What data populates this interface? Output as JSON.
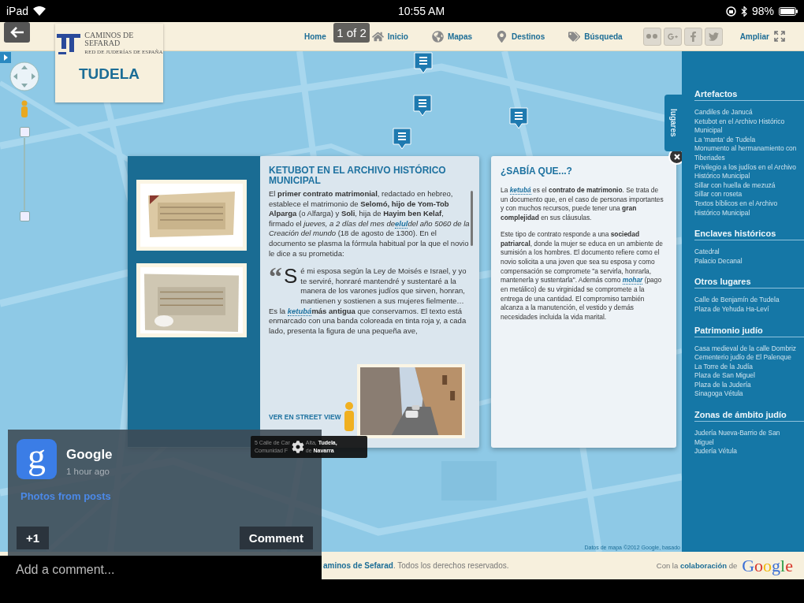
{
  "status_bar": {
    "device": "iPad",
    "time": "10:55 AM",
    "battery": "98%"
  },
  "header": {
    "logo": {
      "title_lines": [
        "CAMINOS DE",
        "SEFARAD"
      ],
      "subtitle": "RED DE JUDERÍAS DE ESPAÑA",
      "city": "TUDELA"
    },
    "nav": [
      {
        "label": "Home",
        "kind": "text"
      },
      {
        "label": "Inicio",
        "kind": "home"
      },
      {
        "label": "Mapas",
        "kind": "globe"
      },
      {
        "label": "Destinos",
        "kind": "pin"
      },
      {
        "label": "Búsqueda",
        "kind": "tags"
      }
    ],
    "page_badge": "1 of 2",
    "social": [
      {
        "kind": "flickr"
      },
      {
        "kind": "gplus"
      },
      {
        "kind": "facebook"
      },
      {
        "kind": "twitter"
      }
    ],
    "expand_label": "Ampliar"
  },
  "map": {
    "attribution": "Datos de mapa ©2012 Google, basado",
    "side_tab": "lugares"
  },
  "popup": {
    "title": "KETUBOT EN EL ARCHIVO HISTÓRICO MUNICIPAL",
    "intro": [
      {
        "kind": "plain",
        "text": "El **primer contrato matrimonial**, redactado en hebreo, establece el matrimonio de **Selomó, hijo de Yom-Tob Alparga** (o Alfarga) y **Soli**, hija de **Hayim ben Kelaf**, firmado el *jueves, a 2 días del mes de*"
      },
      {
        "kind": "link",
        "text": "elul"
      },
      {
        "kind": "plain",
        "text": "*del año 5060 de la Creación del mundo* (18 de agosto de 1300). En el documento se plasma la fórmula habitual por la que el novio le dice a su prometida:"
      }
    ],
    "quote": {
      "mark": "“",
      "initial": "S",
      "text": "é mi esposa según la Ley de Moisés e Israel, y yo te serviré, honraré mantendré y sustentaré a la manera de los varones judíos que sirven, honran, mantienen y sostienen a sus mujeres fielmente…"
    },
    "outro": [
      {
        "kind": "plain",
        "text": "Es la "
      },
      {
        "kind": "link",
        "text": "ketubá"
      },
      {
        "kind": "plain",
        "text": "**más antigua** que conservamos. El texto está enmarcado con una banda coloreada en tinta roja y, a cada lado, presenta la figura de una pequeña ave,"
      }
    ],
    "street_view_link": "VER EN STREET VIEW"
  },
  "tooltip": {
    "lines": [
      [
        "5 Calle de Car",
        "Alta, **Tudela,**"
      ],
      [
        "Comunidad F",
        "de **Navarra**"
      ]
    ]
  },
  "fact_box": {
    "title": "¿SABÍA QUE...?",
    "paragraphs": [
      [
        {
          "kind": "plain",
          "text": "La "
        },
        {
          "kind": "link",
          "text": "ketubá"
        },
        {
          "kind": "plain",
          "text": " es el **contrato de matrimonio**. Se trata de un documento que, en el caso de personas importantes y con muchos recursos, puede tener una **gran complejidad** en sus cláusulas."
        }
      ],
      [
        {
          "kind": "plain",
          "text": "Este tipo de contrato responde a una **sociedad patriarcal**, donde la mujer se educa en un ambiente de sumisión a los hombres. El documento refiere como el novio solicita a una joven que sea su esposa y como compensación se compromete \"a servirla, honrarla, mantenerla y sustentarla\". Además como "
        },
        {
          "kind": "link",
          "text": "mohar"
        },
        {
          "kind": "plain",
          "text": " (pago en metálico) de su virginidad se compromete a la entrega de una cantidad. El compromiso también alcanza a la manutención, el vestido y demás necesidades incluida la vida marital."
        }
      ]
    ]
  },
  "sidebar": {
    "sections": [
      {
        "heading": "Artefactos",
        "items": [
          "Candiles de Janucá",
          "Ketubot en el Archivo Histórico Municipal",
          "La 'manta' de Tudela",
          "Monumento al hermanamiento con Tiberiades",
          "Privilegio a los judíos en el Archivo Histórico Municipal",
          "Sillar con huella de mezuzá",
          "Sillar con roseta",
          "Textos bíblicos en el Archivo Histórico Municipal"
        ]
      },
      {
        "heading": "Enclaves históricos",
        "items": [
          "Catedral",
          "Palacio Decanal"
        ]
      },
      {
        "heading": "Otros lugares",
        "items": [
          "Calle de Benjamín de Tudela",
          "Plaza de Yehuda Ha-Leví"
        ]
      },
      {
        "heading": "Patrimonio judío",
        "items": [
          "Casa medieval de la calle Dombriz",
          "Cementerio judío de El Palenque",
          "La Torre de la Judía",
          "Plaza de San Miguel",
          "Plaza de la Judería",
          "Sinagoga Vétula"
        ]
      },
      {
        "heading": "Zonas de ámbito judío",
        "items": [
          "Judería Nueva-Barrio de San Miguel",
          "Judería Vétula"
        ]
      }
    ]
  },
  "gplus": {
    "avatar": "g",
    "name": "Google",
    "time": "1 hour ago",
    "section_link": "Photos from posts",
    "plus_button": "+1",
    "comment_button": "Comment",
    "comment_placeholder": "Add a comment..."
  },
  "footer": {
    "copyright": [
      {
        "kind": "link",
        "text": "aminos de Sefarad"
      },
      {
        "kind": "plain",
        "text": ". Todos los derechos reservados."
      }
    ],
    "credit": "Con la **colaboración** de",
    "credit_logo": "Google"
  }
}
